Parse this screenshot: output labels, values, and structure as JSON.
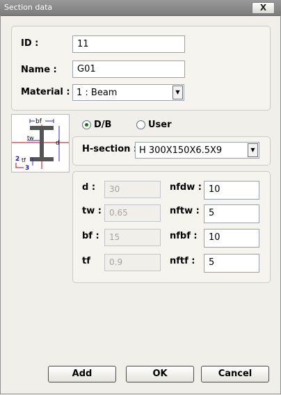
{
  "window": {
    "title": "Section data",
    "close_glyph": "X"
  },
  "general": {
    "id_label": "ID :",
    "id_value": "11",
    "name_label": "Name :",
    "name_value": "G01",
    "material_label": "Material :",
    "material_value": "1 : Beam"
  },
  "diagram": {
    "icon": "h-section-diagram",
    "labels": {
      "bf": "bf",
      "tw": "tw",
      "d": "d",
      "tf": "tf",
      "axis2": "2",
      "axis3": "3"
    },
    "colors": {
      "section": "#555555",
      "dimension": "#2a2ad0",
      "axis_red": "#cc0000",
      "axis_blue": "#1a1ac0"
    }
  },
  "source": {
    "db_label": "D/B",
    "user_label": "User",
    "selected": "D/B"
  },
  "hsection": {
    "label": "H-section :",
    "value": "H 300X150X6.5X9"
  },
  "dims": [
    {
      "label": "d :",
      "value": "30",
      "n_label": "nfdw :",
      "n_value": "10"
    },
    {
      "label": "tw :",
      "value": "0.65",
      "n_label": "nftw :",
      "n_value": "5"
    },
    {
      "label": "bf :",
      "value": "15",
      "n_label": "nfbf :",
      "n_value": "10"
    },
    {
      "label": "tf",
      "value": "0.9",
      "n_label": "nftf :",
      "n_value": "5"
    }
  ],
  "buttons": {
    "add": "Add",
    "ok": "OK",
    "cancel": "Cancel"
  }
}
